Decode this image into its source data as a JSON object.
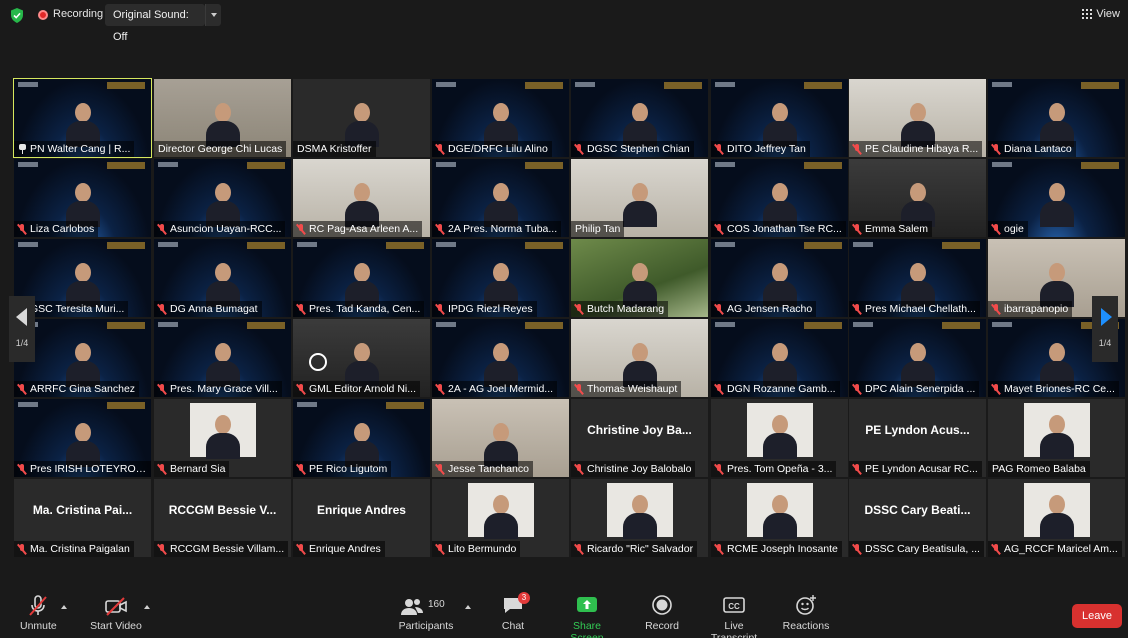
{
  "topbar": {
    "recording_label": "Recording",
    "original_sound": "Original Sound: Off",
    "view_label": "View"
  },
  "participants": [
    {
      "name": "PN Walter Cang  |  R...",
      "bg": "rotary",
      "icon": "pin",
      "active": true
    },
    {
      "name": "Director George Chi Lucas",
      "bg": "room",
      "icon": "none"
    },
    {
      "name": "DSMA Kristoffer",
      "bg": "plain",
      "icon": "none"
    },
    {
      "name": "DGE/DRFC Lilu Alino",
      "bg": "rotary",
      "icon": "mute"
    },
    {
      "name": "DGSC Stephen Chian",
      "bg": "rotary",
      "icon": "mute"
    },
    {
      "name": "DITO Jeffrey Tan",
      "bg": "rotary",
      "icon": "mute"
    },
    {
      "name": "PE Claudine Hibaya R...",
      "bg": "light",
      "icon": "mute"
    },
    {
      "name": "Diana Lantaco",
      "bg": "rotary",
      "icon": "mute"
    },
    {
      "name": "Liza Carlobos",
      "bg": "rotary",
      "icon": "mute"
    },
    {
      "name": "Asuncion Uayan-RCC...",
      "bg": "rotary",
      "icon": "mute"
    },
    {
      "name": "RC Pag-Asa Arleen A...",
      "bg": "light",
      "icon": "mute"
    },
    {
      "name": "2A Pres. Norma Tuba...",
      "bg": "rotary",
      "icon": "mute"
    },
    {
      "name": "Philip Tan",
      "bg": "light",
      "icon": "none"
    },
    {
      "name": "COS Jonathan Tse RC...",
      "bg": "rotary",
      "icon": "mute"
    },
    {
      "name": "Emma Salem",
      "bg": "dark",
      "icon": "mute"
    },
    {
      "name": "ogie",
      "bg": "rotary",
      "icon": "mute"
    },
    {
      "name": "GSC Teresita Muri...",
      "bg": "rotary",
      "icon": "mute"
    },
    {
      "name": "DG Anna Bumagat",
      "bg": "rotary",
      "icon": "mute"
    },
    {
      "name": "Pres. Tad Kanda, Cen...",
      "bg": "rotary",
      "icon": "mute"
    },
    {
      "name": "IPDG Riezl Reyes",
      "bg": "rotary",
      "icon": "mute"
    },
    {
      "name": "Butch Madarang",
      "bg": "green",
      "icon": "mute"
    },
    {
      "name": "AG Jensen Racho",
      "bg": "rotary",
      "icon": "mute"
    },
    {
      "name": "Pres Michael Chellath...",
      "bg": "rotary",
      "icon": "mute"
    },
    {
      "name": "ibarrapanopio",
      "bg": "office",
      "icon": "mute"
    },
    {
      "name": "ARRFC Gina Sanchez",
      "bg": "rotary",
      "icon": "mute"
    },
    {
      "name": "Pres. Mary Grace Vill...",
      "bg": "rotary",
      "icon": "mute"
    },
    {
      "name": "GML Editor Arnold Ni...",
      "bg": "dark",
      "icon": "mute",
      "spinner": true
    },
    {
      "name": "2A - AG Joel Mermid...",
      "bg": "rotary",
      "icon": "mute"
    },
    {
      "name": "Thomas Weishaupt",
      "bg": "light",
      "icon": "mute"
    },
    {
      "name": "DGN Rozanne Gamb...",
      "bg": "rotary",
      "icon": "mute"
    },
    {
      "name": "DPC Alain Senerpida ...",
      "bg": "rotary",
      "icon": "mute"
    },
    {
      "name": "Mayet Briones-RC Ce...",
      "bg": "rotary",
      "icon": "mute"
    },
    {
      "name": "Pres IRISH LOTEYRO/...",
      "bg": "rotary",
      "icon": "mute"
    },
    {
      "name": "Bernard Sia",
      "bg": "plain",
      "icon": "mute",
      "photo": true
    },
    {
      "name": "PE Rico Ligutom",
      "bg": "rotary",
      "icon": "mute"
    },
    {
      "name": "Jesse Tanchanco",
      "bg": "office",
      "icon": "mute"
    },
    {
      "name": "Christine Joy Balobalo",
      "bg": "plain",
      "icon": "mute",
      "display": "Christine Joy Ba..."
    },
    {
      "name": "Pres. Tom Opeña - 3...",
      "bg": "plain",
      "icon": "mute",
      "photo": true
    },
    {
      "name": "PE Lyndon Acusar RC...",
      "bg": "plain",
      "icon": "mute",
      "display": "PE Lyndon Acus..."
    },
    {
      "name": "PAG Romeo Balaba",
      "bg": "plain",
      "icon": "none",
      "photo": true
    },
    {
      "name": "Ma. Cristina Paigalan",
      "bg": "plain",
      "icon": "mute",
      "display": "Ma. Cristina Pai..."
    },
    {
      "name": "RCCGM Bessie Villam...",
      "bg": "plain",
      "icon": "mute",
      "display": "RCCGM Bessie V..."
    },
    {
      "name": "Enrique Andres",
      "bg": "plain",
      "icon": "mute",
      "display": "Enrique Andres"
    },
    {
      "name": "Lito Bermundo",
      "bg": "plain",
      "icon": "mute",
      "photo": true
    },
    {
      "name": "Ricardo \"Ric\" Salvador",
      "bg": "plain",
      "icon": "mute",
      "photo": true
    },
    {
      "name": "RCME Joseph Inosante",
      "bg": "plain",
      "icon": "mute",
      "photo": true
    },
    {
      "name": "DSSC Cary Beatisula, ...",
      "bg": "plain",
      "icon": "mute",
      "display": "DSSC Cary Beati..."
    },
    {
      "name": "AG_RCCF Maricel Am...",
      "bg": "plain",
      "icon": "mute",
      "photo": true
    }
  ],
  "pager": {
    "left": "1/4",
    "right": "1/4"
  },
  "toolbar": {
    "unmute": "Unmute",
    "start_video": "Start Video",
    "participants": "Participants",
    "participants_count": "160",
    "chat": "Chat",
    "chat_badge": "3",
    "share_screen": "Share Screen",
    "record": "Record",
    "live_transcript": "Live Transcript",
    "reactions": "Reactions",
    "leave": "Leave"
  },
  "colors": {
    "active_outline": "#d6e75e",
    "share_green": "#33cc55",
    "leave_red": "#d8312f",
    "mute_red": "#f24b4b"
  }
}
